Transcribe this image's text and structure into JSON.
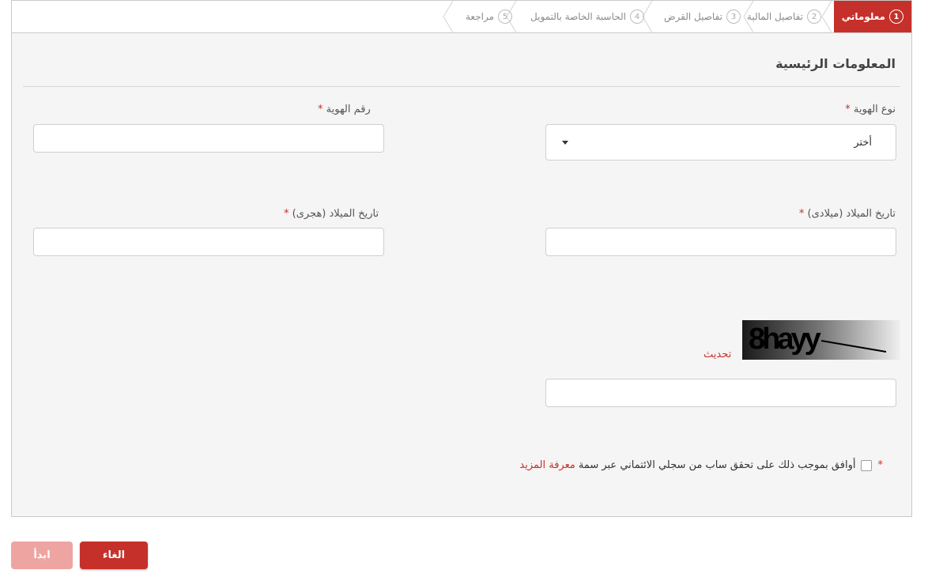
{
  "steps": [
    {
      "num": "1",
      "label": "معلوماتي",
      "active": true
    },
    {
      "num": "2",
      "label": "تفاصيل المالية",
      "active": false
    },
    {
      "num": "3",
      "label": "تفاصيل القرض",
      "active": false
    },
    {
      "num": "4",
      "label": "الحاسبة الخاصة بالتمويل",
      "active": false
    },
    {
      "num": "5",
      "label": "مراجعة",
      "active": false
    }
  ],
  "section_title": "المعلومات الرئيسية",
  "fields": {
    "id_type": {
      "label": "نوع الهوية",
      "required": "*",
      "selected": "أختر"
    },
    "id_number": {
      "label": "رقم الهوية",
      "required": "*",
      "value": ""
    },
    "dob_gregorian": {
      "label": "تاريخ الميلاد (ميلادى)",
      "required": "*",
      "value": ""
    },
    "dob_hijri": {
      "label": "تاريخ الميلاد (هجرى)",
      "required": "*",
      "value": ""
    },
    "captcha_input": {
      "value": ""
    }
  },
  "captcha": {
    "text": "8hayy",
    "refresh_label": "تحديث"
  },
  "agreement": {
    "required": "*",
    "text": "أوافق بموجب ذلك على تحقق ساب من سجلي الائتماني عبر سمة",
    "link": "معرفة المزيد"
  },
  "buttons": {
    "cancel": "الغاء",
    "start": "ابدأ"
  },
  "colors": {
    "accent": "#c6302a",
    "accent_disabled": "#eea5a2"
  }
}
